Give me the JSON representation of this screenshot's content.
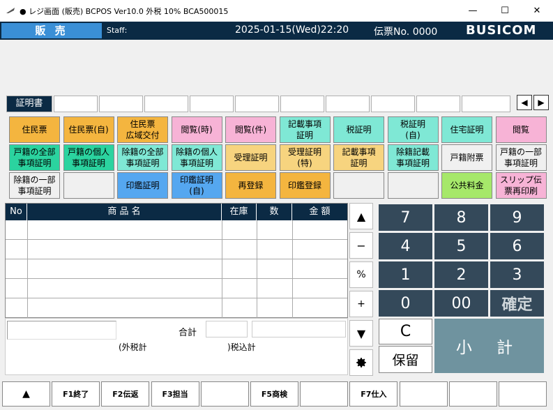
{
  "window": {
    "title": "● レジ画面 (販売)  BCPOS Ver10.0  外税 10%  BCA500015",
    "minimize": "—",
    "maximize": "☐",
    "close": "✕"
  },
  "header": {
    "mode": "販 売",
    "staff": "Staff:",
    "datetime": "2025-01-15(Wed)22:20",
    "slip": "伝票No. 0000",
    "brand": "BUSICOM"
  },
  "tabs": {
    "active": "証明書",
    "left_arrow": "◀",
    "right_arrow": "▶"
  },
  "function_buttons": [
    [
      "住民票",
      "住民票(自)",
      "住民票\n広域交付",
      "閲覧(時)",
      "閲覧(件)",
      "記載事項\n証明",
      "税証明",
      "税証明\n(自)",
      "住宅証明",
      "閲覧"
    ],
    [
      "戸籍の全部\n事項証明",
      "戸籍の個人\n事項証明",
      "除籍の全部\n事項証明",
      "除籍の個人\n事項証明",
      "受理証明",
      "受理証明\n(特)",
      "記載事項\n証明",
      "除籍記載\n事項証明",
      "戸籍附票",
      "戸籍の一部\n事項証明"
    ],
    [
      "除籍の一部\n事項証明",
      "",
      "印鑑証明",
      "印鑑証明\n(自)",
      "再登録",
      "印鑑登録",
      "",
      "",
      "公共料金",
      "スリップ伝\n票再印刷"
    ]
  ],
  "colors": {
    "navy": "#0b2a44",
    "mode_blue": "#3a8fd6",
    "orange": "#f4b53f",
    "pink": "#f7b3d6",
    "cyan": "#7fe8d5",
    "teal": "#2bd39f",
    "blue": "#55a7f0",
    "yellow_green": "#a6e86a",
    "light_orange": "#f7d47f",
    "key": "#34495a",
    "subtotal": "#6f939f"
  },
  "table": {
    "headers": [
      "No",
      "商 品 名",
      "在庫",
      "数",
      "金 額"
    ]
  },
  "scroll": {
    "up": "▲",
    "minus": "−",
    "percent": "%",
    "plus": "+",
    "down": "▼",
    "settings_icon": "gear-icon"
  },
  "totals": {
    "total_label": "合計",
    "tax_excl_label": "(外税計",
    "tax_incl_label": ")税込計"
  },
  "keypad": {
    "k7": "7",
    "k8": "8",
    "k9": "9",
    "k4": "4",
    "k5": "5",
    "k6": "6",
    "k1": "1",
    "k2": "2",
    "k3": "3",
    "k0": "0",
    "k00": "00",
    "confirm": "確定",
    "clear": "C",
    "hold": "保留",
    "subtotal": "小 計"
  },
  "fkeys": [
    "▲",
    "F1終了",
    "F2伝返",
    "F3担当",
    "",
    "F5商検",
    "",
    "F7仕入",
    "",
    "",
    ""
  ]
}
